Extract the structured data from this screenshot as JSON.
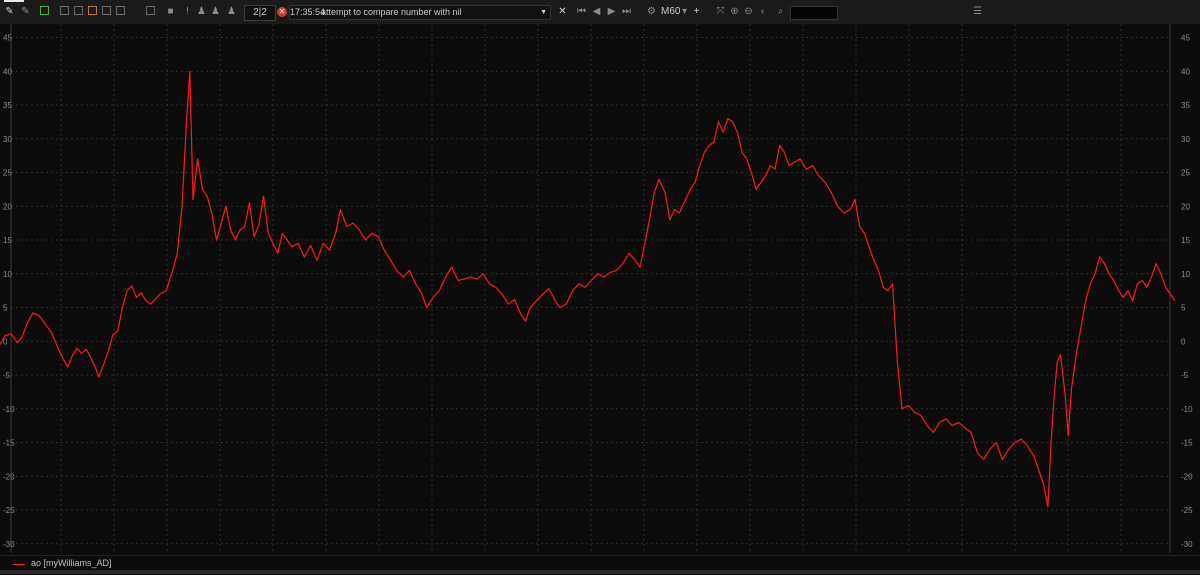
{
  "toolbar": {
    "counter": "2|2",
    "message_time": "17:35:54",
    "message_text": "attempt to compare number with nil",
    "timeframe": "M60",
    "icons": [
      "draw-icon",
      "draw-icon-2",
      "new-window-icon",
      "window-icon",
      "window-icon-2",
      "window-icon-3",
      "window-icon-4",
      "window-icon-5",
      "window-icon-6",
      "alert-icon",
      "warning-icon",
      "script-icon",
      "script-icon-2",
      "script-icon-3",
      "close-icon",
      "first-icon",
      "prev-icon",
      "next-icon",
      "last-icon",
      "timeframe-icon",
      "plus-icon",
      "fit-icon",
      "zoom-in-icon",
      "zoom-out-icon",
      "collapse-icon",
      "search-icon",
      "panel-icon"
    ]
  },
  "colors": {
    "background": "#0c0c0c",
    "grid": "#3a3a3a",
    "series": "#ff1a1a",
    "error": "#d43b1e"
  },
  "legend": {
    "label": "ao [myWilliams_AD]"
  },
  "chart_data": {
    "type": "line",
    "ylim": [
      -31,
      46
    ],
    "yticks": [
      45,
      40,
      35,
      30,
      25,
      20,
      15,
      10,
      5,
      0,
      -5,
      -10,
      -15,
      -20,
      -25,
      -30
    ],
    "grid": true,
    "legend_position": "bottom-left",
    "series": [
      {
        "name": "ao [myWilliams_AD]",
        "color": "#ff1a1a",
        "points": [
          [
            0,
            -0.5
          ],
          [
            3,
            0.8
          ],
          [
            7,
            1.1
          ],
          [
            11,
            -0.2
          ],
          [
            14,
            0.6
          ],
          [
            17,
            2.5
          ],
          [
            21,
            4.2
          ],
          [
            25,
            3.8
          ],
          [
            29,
            2.5
          ],
          [
            33,
            1.2
          ],
          [
            37,
            -1.0
          ],
          [
            40,
            -2.5
          ],
          [
            43,
            -3.8
          ],
          [
            46,
            -2.2
          ],
          [
            49,
            -1.0
          ],
          [
            52,
            -1.8
          ],
          [
            55,
            -1.2
          ],
          [
            58,
            -2.5
          ],
          [
            61,
            -4.0
          ],
          [
            63,
            -5.3
          ],
          [
            66,
            -3.5
          ],
          [
            69,
            -1.5
          ],
          [
            72,
            1.0
          ],
          [
            75,
            1.5
          ],
          [
            78,
            5.0
          ],
          [
            81,
            7.5
          ],
          [
            84,
            8.2
          ],
          [
            87,
            6.5
          ],
          [
            90,
            7.2
          ],
          [
            93,
            6.0
          ],
          [
            96,
            5.5
          ],
          [
            99,
            6.2
          ],
          [
            102,
            7.0
          ],
          [
            106,
            7.5
          ],
          [
            110,
            10.5
          ],
          [
            113,
            13.0
          ],
          [
            116,
            20.0
          ],
          [
            119,
            33.0
          ],
          [
            121,
            40.0
          ],
          [
            123,
            21.0
          ],
          [
            126,
            27.0
          ],
          [
            129,
            22.5
          ],
          [
            132,
            21.5
          ],
          [
            135,
            19.0
          ],
          [
            138,
            15.0
          ],
          [
            141,
            17.5
          ],
          [
            144,
            20.0
          ],
          [
            147,
            16.5
          ],
          [
            150,
            15.0
          ],
          [
            153,
            16.5
          ],
          [
            156,
            17.0
          ],
          [
            159,
            20.5
          ],
          [
            162,
            15.5
          ],
          [
            165,
            17.2
          ],
          [
            168,
            21.5
          ],
          [
            171,
            16.0
          ],
          [
            174,
            14.5
          ],
          [
            177,
            13.0
          ],
          [
            180,
            16.0
          ],
          [
            183,
            15.0
          ],
          [
            186,
            14.0
          ],
          [
            190,
            14.5
          ],
          [
            194,
            12.5
          ],
          [
            198,
            14.2
          ],
          [
            202,
            12.0
          ],
          [
            206,
            14.5
          ],
          [
            210,
            13.5
          ],
          [
            214,
            16.0
          ],
          [
            217,
            19.5
          ],
          [
            221,
            17.0
          ],
          [
            225,
            17.5
          ],
          [
            229,
            16.5
          ],
          [
            233,
            15.0
          ],
          [
            237,
            16.0
          ],
          [
            241,
            15.5
          ],
          [
            245,
            13.5
          ],
          [
            249,
            12.0
          ],
          [
            253,
            10.5
          ],
          [
            257,
            9.5
          ],
          [
            261,
            10.5
          ],
          [
            265,
            8.5
          ],
          [
            269,
            7.0
          ],
          [
            272,
            5.0
          ],
          [
            276,
            6.5
          ],
          [
            280,
            7.5
          ],
          [
            284,
            9.5
          ],
          [
            288,
            11.0
          ],
          [
            292,
            9.0
          ],
          [
            296,
            9.2
          ],
          [
            300,
            9.5
          ],
          [
            304,
            9.2
          ],
          [
            308,
            10.0
          ],
          [
            312,
            8.5
          ],
          [
            316,
            8.0
          ],
          [
            320,
            7.0
          ],
          [
            324,
            5.5
          ],
          [
            328,
            6.2
          ],
          [
            332,
            4.0
          ],
          [
            335,
            3.0
          ],
          [
            338,
            5.0
          ],
          [
            342,
            6.0
          ],
          [
            346,
            7.0
          ],
          [
            350,
            7.8
          ],
          [
            354,
            6.0
          ],
          [
            357,
            5.0
          ],
          [
            361,
            5.5
          ],
          [
            365,
            7.5
          ],
          [
            369,
            8.5
          ],
          [
            373,
            8.0
          ],
          [
            377,
            9.0
          ],
          [
            381,
            10.0
          ],
          [
            385,
            9.5
          ],
          [
            389,
            10.2
          ],
          [
            393,
            10.5
          ],
          [
            397,
            11.5
          ],
          [
            401,
            13.0
          ],
          [
            405,
            12.0
          ],
          [
            408,
            11.0
          ],
          [
            411,
            14.5
          ],
          [
            414,
            18.0
          ],
          [
            417,
            22.0
          ],
          [
            420,
            24.0
          ],
          [
            424,
            22.0
          ],
          [
            427,
            18.0
          ],
          [
            430,
            19.5
          ],
          [
            433,
            19.0
          ],
          [
            436,
            20.5
          ],
          [
            440,
            22.5
          ],
          [
            443,
            23.5
          ],
          [
            446,
            26.0
          ],
          [
            449,
            28.0
          ],
          [
            452,
            29.0
          ],
          [
            455,
            29.5
          ],
          [
            458,
            32.5
          ],
          [
            461,
            31.0
          ],
          [
            464,
            33.0
          ],
          [
            467,
            32.5
          ],
          [
            470,
            31.0
          ],
          [
            473,
            28.0
          ],
          [
            476,
            27.0
          ],
          [
            479,
            25.0
          ],
          [
            482,
            22.5
          ],
          [
            485,
            23.5
          ],
          [
            488,
            24.5
          ],
          [
            491,
            26.0
          ],
          [
            494,
            25.5
          ],
          [
            497,
            29.0
          ],
          [
            500,
            28.0
          ],
          [
            503,
            26.0
          ],
          [
            506,
            26.5
          ],
          [
            510,
            27.0
          ],
          [
            514,
            25.5
          ],
          [
            518,
            26.0
          ],
          [
            522,
            24.5
          ],
          [
            526,
            23.5
          ],
          [
            530,
            22.0
          ],
          [
            534,
            20.0
          ],
          [
            538,
            19.0
          ],
          [
            542,
            19.5
          ],
          [
            545,
            21.0
          ],
          [
            548,
            17.0
          ],
          [
            551,
            16.0
          ],
          [
            554,
            14.0
          ],
          [
            557,
            12.0
          ],
          [
            560,
            10.5
          ],
          [
            563,
            8.0
          ],
          [
            566,
            7.5
          ],
          [
            569,
            8.5
          ],
          [
            572,
            -3.0
          ],
          [
            575,
            -10.0
          ],
          [
            579,
            -9.5
          ],
          [
            583,
            -10.5
          ],
          [
            587,
            -11.0
          ],
          [
            591,
            -12.5
          ],
          [
            595,
            -13.5
          ],
          [
            599,
            -12.0
          ],
          [
            603,
            -11.5
          ],
          [
            607,
            -12.5
          ],
          [
            611,
            -12.0
          ],
          [
            615,
            -12.8
          ],
          [
            619,
            -13.5
          ],
          [
            623,
            -16.5
          ],
          [
            627,
            -17.5
          ],
          [
            631,
            -16.0
          ],
          [
            635,
            -15.0
          ],
          [
            639,
            -17.5
          ],
          [
            643,
            -16.0
          ],
          [
            647,
            -15.0
          ],
          [
            651,
            -14.5
          ],
          [
            655,
            -15.5
          ],
          [
            659,
            -17.0
          ],
          [
            662,
            -19.0
          ],
          [
            665,
            -21.0
          ],
          [
            668,
            -24.5
          ],
          [
            670,
            -15.0
          ],
          [
            672,
            -8.0
          ],
          [
            674,
            -3.0
          ],
          [
            676,
            -2.0
          ],
          [
            679,
            -8.0
          ],
          [
            681,
            -14.0
          ],
          [
            683,
            -7.0
          ],
          [
            686,
            -2.0
          ],
          [
            689,
            2.0
          ],
          [
            692,
            6.0
          ],
          [
            695,
            8.5
          ],
          [
            698,
            10.0
          ],
          [
            701,
            12.5
          ],
          [
            704,
            11.5
          ],
          [
            707,
            10.0
          ],
          [
            710,
            9.0
          ],
          [
            713,
            7.5
          ],
          [
            716,
            6.5
          ],
          [
            719,
            7.5
          ],
          [
            722,
            6.0
          ],
          [
            725,
            8.5
          ],
          [
            728,
            9.0
          ],
          [
            731,
            8.0
          ],
          [
            734,
            9.5
          ],
          [
            737,
            11.5
          ],
          [
            740,
            10.0
          ],
          [
            743,
            8.0
          ],
          [
            746,
            7.0
          ],
          [
            749,
            6.0
          ]
        ]
      }
    ]
  }
}
